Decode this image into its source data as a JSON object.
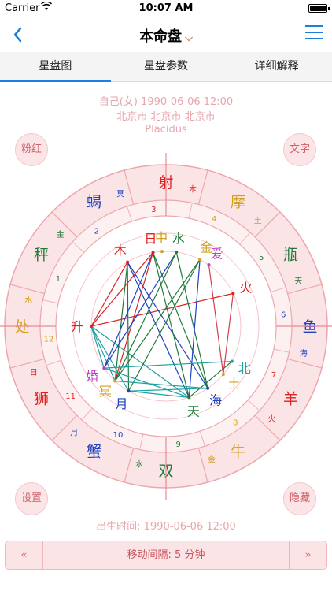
{
  "status_bar": {
    "carrier": "Carrier",
    "time": "10:07 AM"
  },
  "nav": {
    "title": "本命盘",
    "title_arrow": "⌵"
  },
  "tabs": [
    {
      "label": "星盘图",
      "active": true
    },
    {
      "label": "星盘参数",
      "active": false
    },
    {
      "label": "详细解释",
      "active": false
    }
  ],
  "profile": {
    "line1": "自己(女) 1990-06-06 12:00",
    "line2": "北京市 北京市 北京市",
    "house_system": "Placidus"
  },
  "buttons": {
    "pink_red": "粉红",
    "text": "文字",
    "settings": "设置",
    "hide": "隐藏"
  },
  "chart": {
    "signs": [
      {
        "name": "鱼",
        "ruler": "海",
        "house": "6"
      },
      {
        "name": "瓶",
        "ruler": "天",
        "house": "5"
      },
      {
        "name": "摩",
        "ruler": "土",
        "house": "4"
      },
      {
        "name": "射",
        "ruler": "木",
        "house": "3"
      },
      {
        "name": "蝎",
        "ruler": "冥",
        "house": "2"
      },
      {
        "name": "秤",
        "ruler": "金",
        "house": "1"
      },
      {
        "name": "处",
        "ruler": "水",
        "house": "12"
      },
      {
        "name": "狮",
        "ruler": "日",
        "house": "11"
      },
      {
        "name": "蟹",
        "ruler": "月",
        "house": "10"
      },
      {
        "name": "双",
        "ruler": "水",
        "house": "9"
      },
      {
        "name": "牛",
        "ruler": "金",
        "house": "8"
      },
      {
        "name": "羊",
        "ruler": "火",
        "house": "7"
      }
    ],
    "planets": [
      {
        "key": "sun",
        "label": "日",
        "color": "#e02020",
        "deg": 100
      },
      {
        "key": "mercury",
        "label": "水",
        "color": "#1f7a3a",
        "deg": 82
      },
      {
        "key": "venus",
        "label": "金",
        "color": "#d4a020",
        "deg": 63
      },
      {
        "key": "uranus_c",
        "label": "中",
        "color": "#d4a020",
        "deg": 93
      },
      {
        "key": "pluto_love",
        "label": "爱",
        "color": "#c040c0",
        "deg": 55
      },
      {
        "key": "mars",
        "label": "火",
        "color": "#e02020",
        "deg": 26
      },
      {
        "key": "node",
        "label": "北",
        "color": "#20a0a0",
        "deg": -28
      },
      {
        "key": "saturn",
        "label": "土",
        "color": "#d4a020",
        "deg": -40
      },
      {
        "key": "neptune",
        "label": "海",
        "color": "#2040c0",
        "deg": -56
      },
      {
        "key": "uranus",
        "label": "天",
        "color": "#1f7a3a",
        "deg": -72
      },
      {
        "key": "moon",
        "label": "月",
        "color": "#2040c0",
        "deg": -120
      },
      {
        "key": "pluto",
        "label": "冥",
        "color": "#d4a020",
        "deg": -133
      },
      {
        "key": "marriage",
        "label": "婚",
        "color": "#c040c0",
        "deg": -146
      },
      {
        "key": "asc",
        "label": "升",
        "color": "#e02020",
        "deg": 180
      },
      {
        "key": "jupiter",
        "label": "木",
        "color": "#e02020",
        "deg": 121
      }
    ],
    "aspects": [
      {
        "a": "asc",
        "b": "sun",
        "color": "#e02020"
      },
      {
        "a": "asc",
        "b": "mars",
        "color": "#e02020"
      },
      {
        "a": "asc",
        "b": "jupiter",
        "color": "#e02020"
      },
      {
        "a": "asc",
        "b": "marriage",
        "color": "#20a0a0"
      },
      {
        "a": "asc",
        "b": "moon",
        "color": "#20a0a0"
      },
      {
        "a": "asc",
        "b": "uranus",
        "color": "#20a0a0"
      },
      {
        "a": "asc",
        "b": "pluto",
        "color": "#20a0a0"
      },
      {
        "a": "jupiter",
        "b": "pluto",
        "color": "#1f7a3a"
      },
      {
        "a": "jupiter",
        "b": "moon",
        "color": "#1f7a3a"
      },
      {
        "a": "jupiter",
        "b": "neptune",
        "color": "#2040c0"
      },
      {
        "a": "jupiter",
        "b": "uranus",
        "color": "#2040c0"
      },
      {
        "a": "sun",
        "b": "uranus",
        "color": "#1f7a3a"
      },
      {
        "a": "sun",
        "b": "neptune",
        "color": "#1f7a3a"
      },
      {
        "a": "sun",
        "b": "marriage",
        "color": "#2040c0"
      },
      {
        "a": "sun",
        "b": "pluto",
        "color": "#e02020"
      },
      {
        "a": "mercury",
        "b": "marriage",
        "color": "#2040c0"
      },
      {
        "a": "mercury",
        "b": "pluto",
        "color": "#1f7a3a"
      },
      {
        "a": "mercury",
        "b": "neptune",
        "color": "#1f7a3a"
      },
      {
        "a": "venus",
        "b": "moon",
        "color": "#1f7a3a"
      },
      {
        "a": "venus",
        "b": "uranus",
        "color": "#2040c0"
      },
      {
        "a": "venus",
        "b": "pluto",
        "color": "#1f7a3a"
      },
      {
        "a": "pluto_love",
        "b": "saturn",
        "color": "#d04050"
      },
      {
        "a": "mars",
        "b": "saturn",
        "color": "#d04050"
      },
      {
        "a": "node",
        "b": "uranus",
        "color": "#1f7a3a"
      },
      {
        "a": "node",
        "b": "marriage",
        "color": "#20a0a0"
      },
      {
        "a": "moon",
        "b": "uranus",
        "color": "#20a0a0"
      },
      {
        "a": "moon",
        "b": "neptune",
        "color": "#20a0a0"
      },
      {
        "a": "pluto",
        "b": "neptune",
        "color": "#20a0a0"
      },
      {
        "a": "marriage",
        "b": "uranus",
        "color": "#20a0a0"
      }
    ],
    "colors": {
      "ring_outer_fill": "#fbe4e6",
      "ring_stroke": "#eea6ad",
      "house_ring_fill": "#fdf0f1",
      "sign_fire": "#e02020",
      "sign_earth": "#d4a020",
      "sign_air": "#1f7a3a",
      "sign_water": "#2040c0"
    }
  },
  "footer": {
    "birth_time": "出生时间: 1990-06-06 12:00",
    "step_prev": "«",
    "step_next": "»",
    "step_label": "移动间隔: 5 分钟"
  }
}
